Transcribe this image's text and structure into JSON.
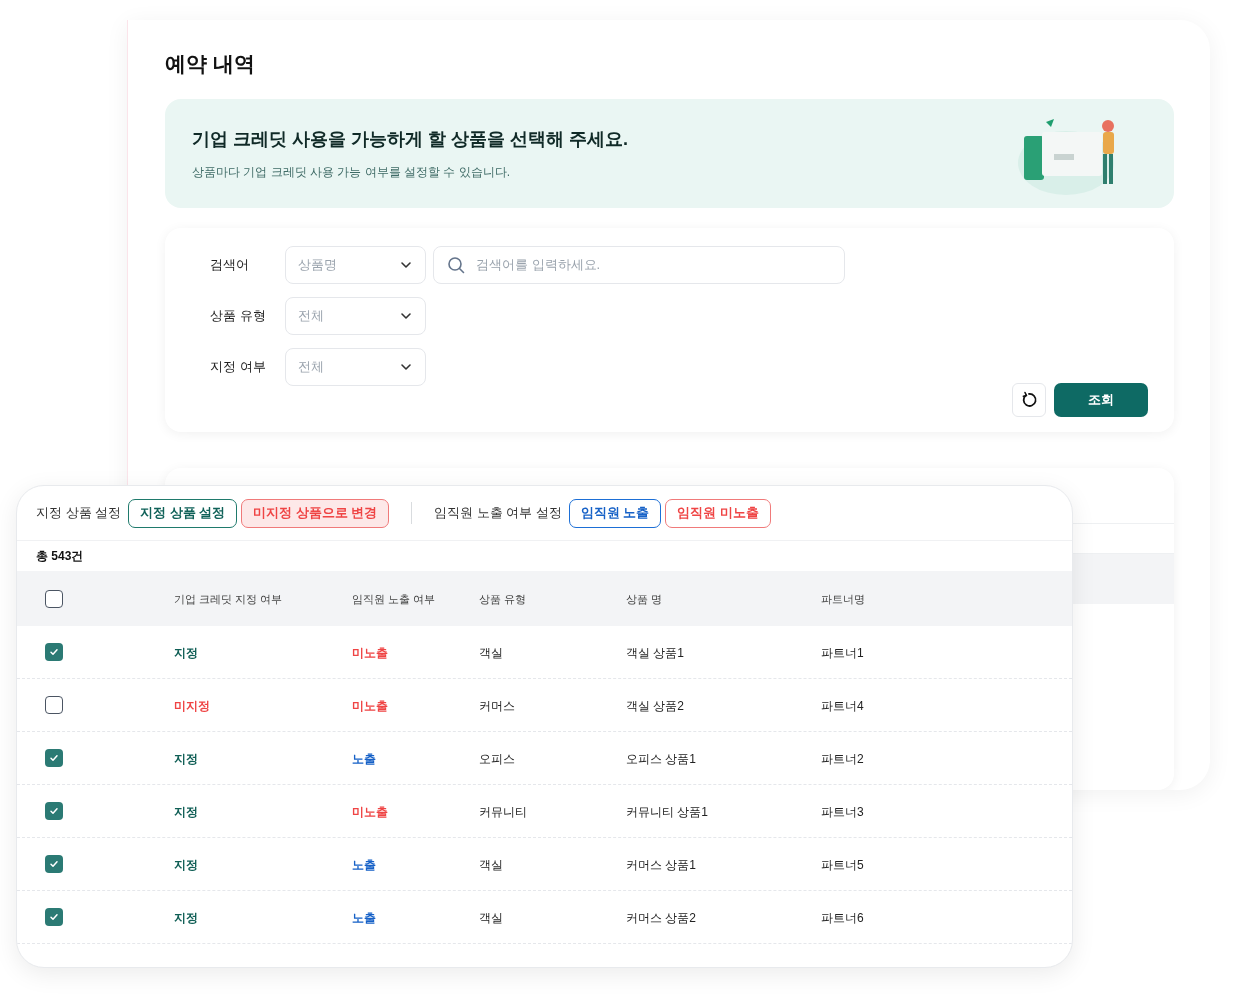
{
  "page": {
    "title": "예약 내역"
  },
  "banner": {
    "title": "기업 크레딧 사용을 가능하게 할 상품을 선택해 주세요.",
    "subtitle": "상품마다 기업 크레딧 사용 가능 여부를 설정할 수 있습니다."
  },
  "filters": [
    {
      "label": "검색어",
      "select": "상품명",
      "search_placeholder": "검색어를 입력하세요."
    },
    {
      "label": "상품 유형",
      "select": "전체"
    },
    {
      "label": "지정 여부",
      "select": "전체"
    }
  ],
  "search_button": "조회",
  "toolbar": {
    "groups": [
      {
        "label": "지정 상품 설정",
        "buttons": [
          {
            "label": "지정 상품 설정",
            "kind": "green"
          },
          {
            "label": "미지정 상품으로 변경",
            "kind": "red-fill"
          }
        ]
      },
      {
        "label": "임직원 노출 여부 설정",
        "buttons": [
          {
            "label": "임직원 노출",
            "kind": "blue"
          },
          {
            "label": "임직원 미노출",
            "kind": "red"
          }
        ]
      }
    ]
  },
  "total": "총 543건",
  "table": {
    "header_checked": false,
    "columns": [
      "기업 크레딧 지정 여부",
      "임직원 노출 여부",
      "상품 유형",
      "상품 명",
      "파트너명"
    ],
    "rows": [
      {
        "checked": true,
        "designation": "지정",
        "designated": true,
        "exposure": "미노출",
        "exposed": false,
        "type": "객실",
        "product": "객실 상품1",
        "partner": "파트너1"
      },
      {
        "checked": false,
        "designation": "미지정",
        "designated": false,
        "exposure": "미노출",
        "exposed": false,
        "type": "커머스",
        "product": "객실 상품2",
        "partner": "파트너4"
      },
      {
        "checked": true,
        "designation": "지정",
        "designated": true,
        "exposure": "노출",
        "exposed": true,
        "type": "오피스",
        "product": "오피스 상품1",
        "partner": "파트너2"
      },
      {
        "checked": true,
        "designation": "지정",
        "designated": true,
        "exposure": "미노출",
        "exposed": false,
        "type": "커뮤니티",
        "product": "커뮤니티 상품1",
        "partner": "파트너3"
      },
      {
        "checked": true,
        "designation": "지정",
        "designated": true,
        "exposure": "노출",
        "exposed": true,
        "type": "객실",
        "product": "커머스 상품1",
        "partner": "파트너5"
      },
      {
        "checked": true,
        "designation": "지정",
        "designated": true,
        "exposure": "노출",
        "exposed": true,
        "type": "객실",
        "product": "커머스 상품2",
        "partner": "파트너6"
      }
    ]
  }
}
